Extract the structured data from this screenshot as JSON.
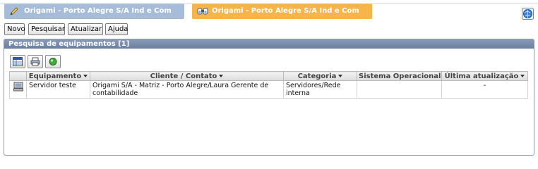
{
  "tabs": [
    {
      "label": "Origami - Porto Alegre S/A Ind e Com Ltda",
      "icon": "pencil-icon",
      "color": "#a7bcd9"
    },
    {
      "label": "Origami - Porto Alegre S/A Ind e Com Ltda",
      "icon": "binoculars-icon",
      "color": "#f7b44a"
    }
  ],
  "toolbar": {
    "novo": "Novo",
    "pesquisar": "Pesquisar",
    "atualizar": "Atualizar",
    "ajuda": "Ajuda"
  },
  "panel": {
    "title": "Pesquisa de equipamentos [1]"
  },
  "table": {
    "columns": [
      "Equipamento",
      "Cliente / Contato",
      "Categoria",
      "Sistema Operacional",
      "Última atualização"
    ],
    "rows": [
      {
        "icon": "computer-icon",
        "equipamento": "Servidor teste",
        "cliente": "Origami S/A - Matriz - Porto Alegre/Laura Gerente de contabilidade",
        "categoria": "Servidores/Rede interna",
        "sistema": "",
        "atualizacao": "-"
      }
    ]
  },
  "colors": {
    "panel_header": "#7487a8",
    "tab_blue": "#a7bcd9",
    "tab_orange": "#f7b44a"
  }
}
